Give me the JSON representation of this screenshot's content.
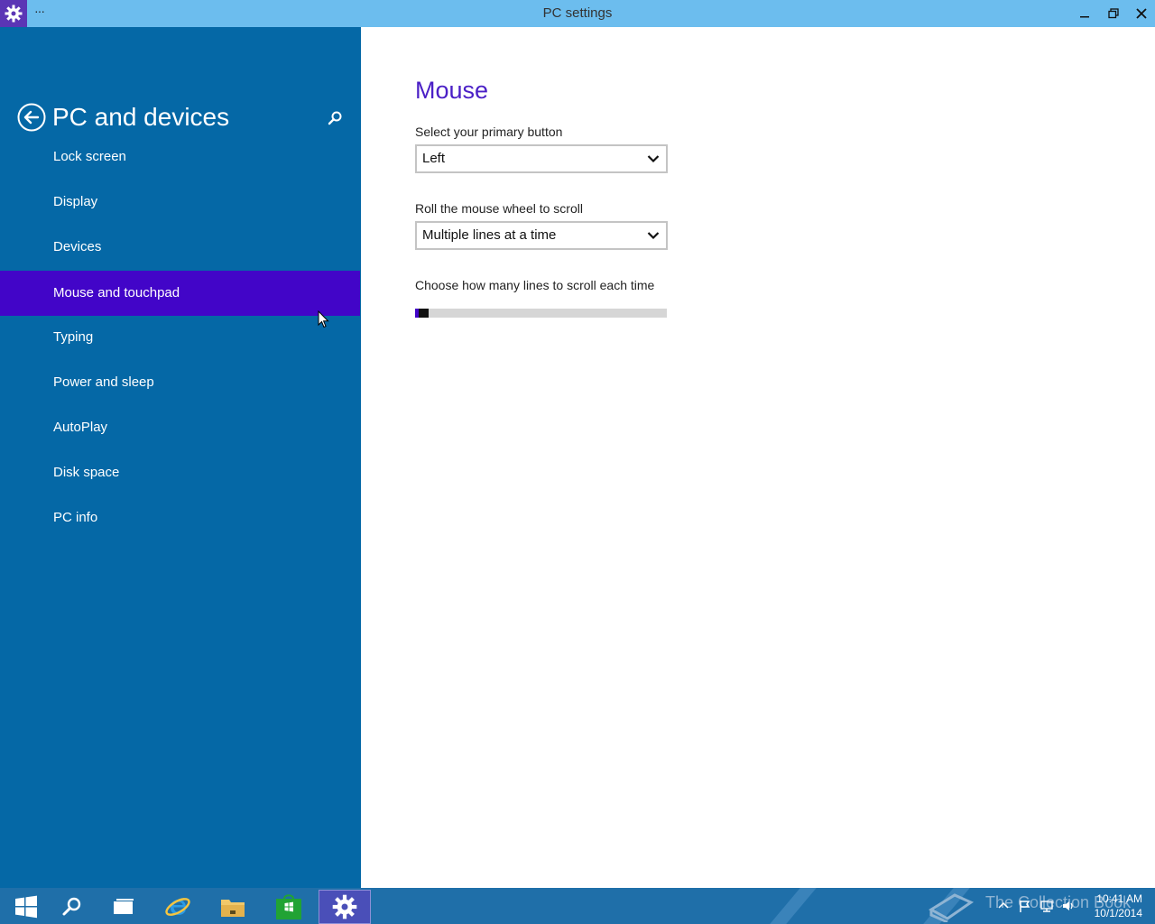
{
  "window": {
    "title": "PC settings",
    "menu_glyph": "···",
    "icon": "gear-icon",
    "accent_color": "#5b35b5",
    "titlebar_color": "#6cbdee"
  },
  "sidebar": {
    "title": "PC and devices",
    "back_icon": "back-arrow-icon",
    "search_icon": "search-icon",
    "background_color": "#0568a6",
    "selected_color": "#4205c8",
    "items": [
      {
        "label": "Lock screen",
        "selected": false
      },
      {
        "label": "Display",
        "selected": false
      },
      {
        "label": "Devices",
        "selected": false
      },
      {
        "label": "Mouse and touchpad",
        "selected": true
      },
      {
        "label": "Typing",
        "selected": false
      },
      {
        "label": "Power and sleep",
        "selected": false
      },
      {
        "label": "AutoPlay",
        "selected": false
      },
      {
        "label": "Disk space",
        "selected": false
      },
      {
        "label": "PC info",
        "selected": false
      }
    ]
  },
  "main": {
    "title": "Mouse",
    "primary_button": {
      "label": "Select your primary button",
      "value": "Left"
    },
    "wheel_scroll": {
      "label": "Roll the mouse wheel to scroll",
      "value": "Multiple lines at a time"
    },
    "lines_slider": {
      "label": "Choose how many lines to scroll each time",
      "fraction": 0.03
    }
  },
  "taskbar": {
    "items": [
      {
        "icon": "windows-start-icon",
        "active": false
      },
      {
        "icon": "search-icon",
        "active": false
      },
      {
        "icon": "task-view-icon",
        "active": false
      },
      {
        "icon": "internet-explorer-icon",
        "active": false
      },
      {
        "icon": "file-explorer-icon",
        "active": false
      },
      {
        "icon": "store-icon",
        "active": false
      },
      {
        "icon": "settings-gear-icon",
        "active": true
      }
    ],
    "watermark": "The Collection Book",
    "tray_icons": [
      "show-hidden-icon",
      "flag-icon",
      "network-icon",
      "volume-icon"
    ],
    "time": "10:41 AM",
    "date": "10/1/2014"
  }
}
